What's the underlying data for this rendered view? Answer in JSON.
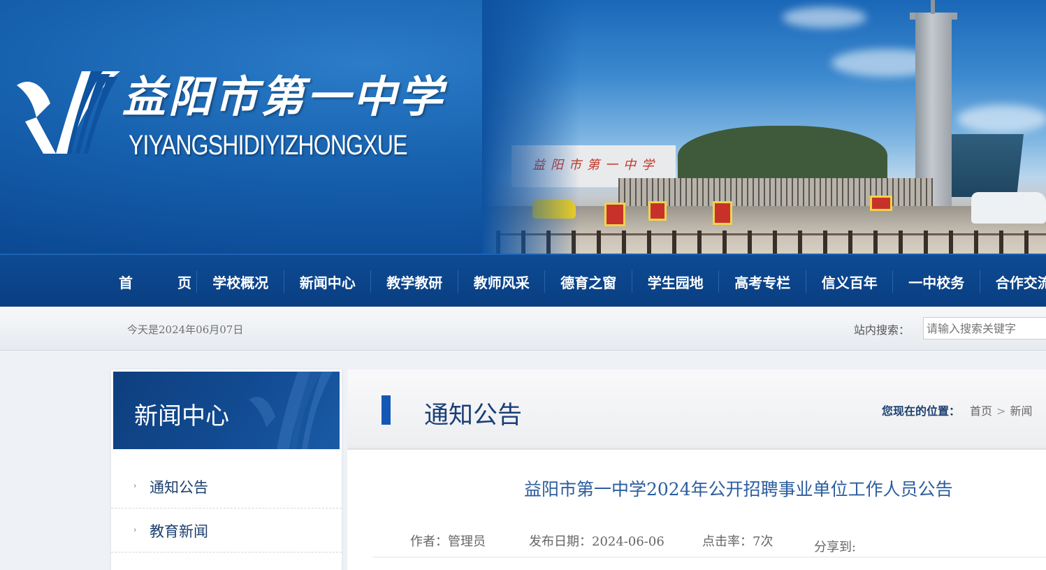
{
  "banner": {
    "school_name_cn": "益阳市第一中学",
    "school_name_en": "YIYANGSHIDIYIZHONGXUE",
    "gate_text": "益阳市第一中学"
  },
  "nav": {
    "home_1": "首",
    "home_2": "页",
    "items": [
      "学校概况",
      "新闻中心",
      "教学教研",
      "教师风采",
      "德育之窗",
      "学生园地",
      "高考专栏",
      "信义百年",
      "一中校务",
      "合作交流"
    ]
  },
  "infobar": {
    "today": "今天是2024年06月07日",
    "search_label": "站内搜索：",
    "search_placeholder": "请输入搜索关键字"
  },
  "sidebar": {
    "title": "新闻中心",
    "items": [
      {
        "label": "通知公告",
        "arrow": "›"
      },
      {
        "label": "教育新闻",
        "arrow": "›"
      }
    ]
  },
  "main": {
    "section_title": "通知公告",
    "breadcrumb": {
      "label": "您现在的位置：",
      "home": "首页",
      "sep": ">",
      "current": "新闻"
    },
    "article": {
      "title": "益阳市第一中学2024年公开招聘事业单位工作人员公告",
      "author": "作者：管理员",
      "date": "发布日期：2024-06-06",
      "clicks": "点击率：7次",
      "share": "分享到:"
    }
  },
  "colors": {
    "nav_bg": "#0a3f82",
    "title_blue": "#1a3f78",
    "article_title": "#2c5d9f",
    "accent": "#1558b3"
  }
}
